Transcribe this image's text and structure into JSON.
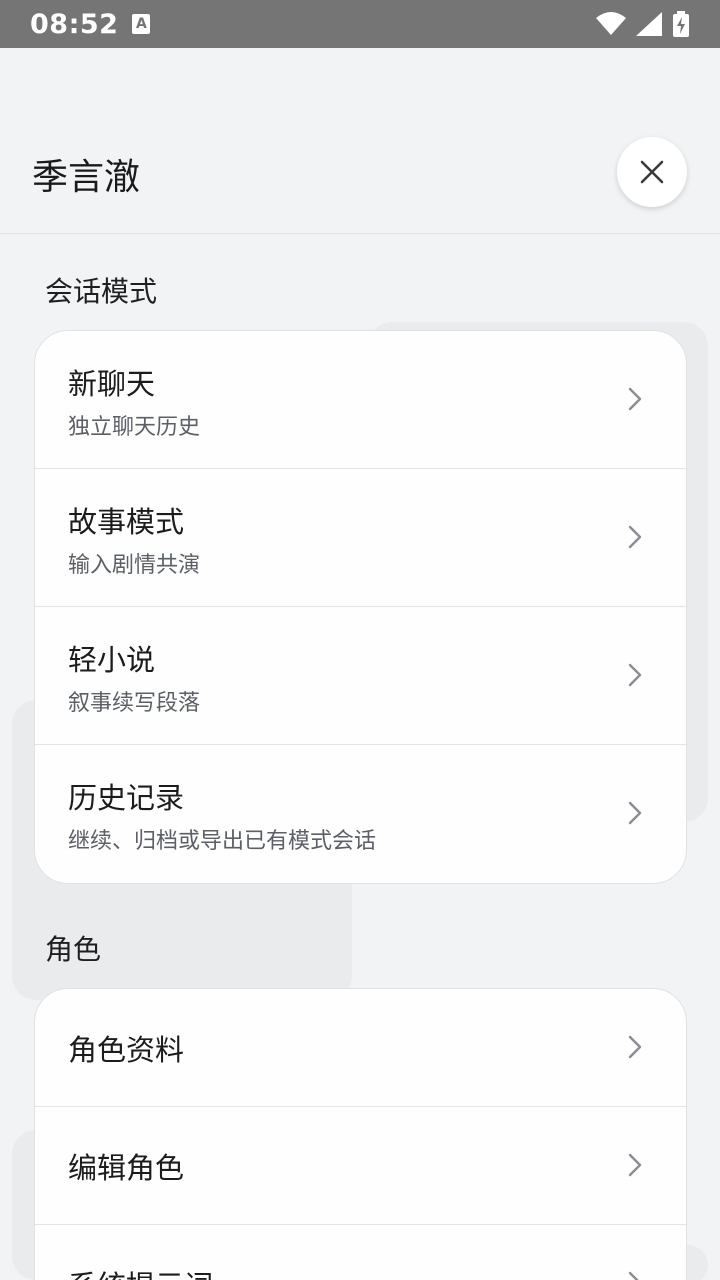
{
  "status_bar": {
    "time": "08:52",
    "notification_letter": "A"
  },
  "header": {
    "title": "季言澈"
  },
  "sections": {
    "session_mode": {
      "label": "会话模式",
      "items": [
        {
          "title": "新聊天",
          "subtitle": "独立聊天历史"
        },
        {
          "title": "故事模式",
          "subtitle": "输入剧情共演"
        },
        {
          "title": "轻小说",
          "subtitle": "叙事续写段落"
        },
        {
          "title": "历史记录",
          "subtitle": "继续、归档或导出已有模式会话"
        }
      ]
    },
    "character": {
      "label": "角色",
      "items": [
        {
          "title": "角色资料"
        },
        {
          "title": "编辑角色"
        },
        {
          "title": "系统提示词"
        }
      ]
    }
  },
  "colors": {
    "status_bar": "#757575",
    "background": "#f2f3f5",
    "card": "#ffffff",
    "chevron": "#8a8d94"
  }
}
